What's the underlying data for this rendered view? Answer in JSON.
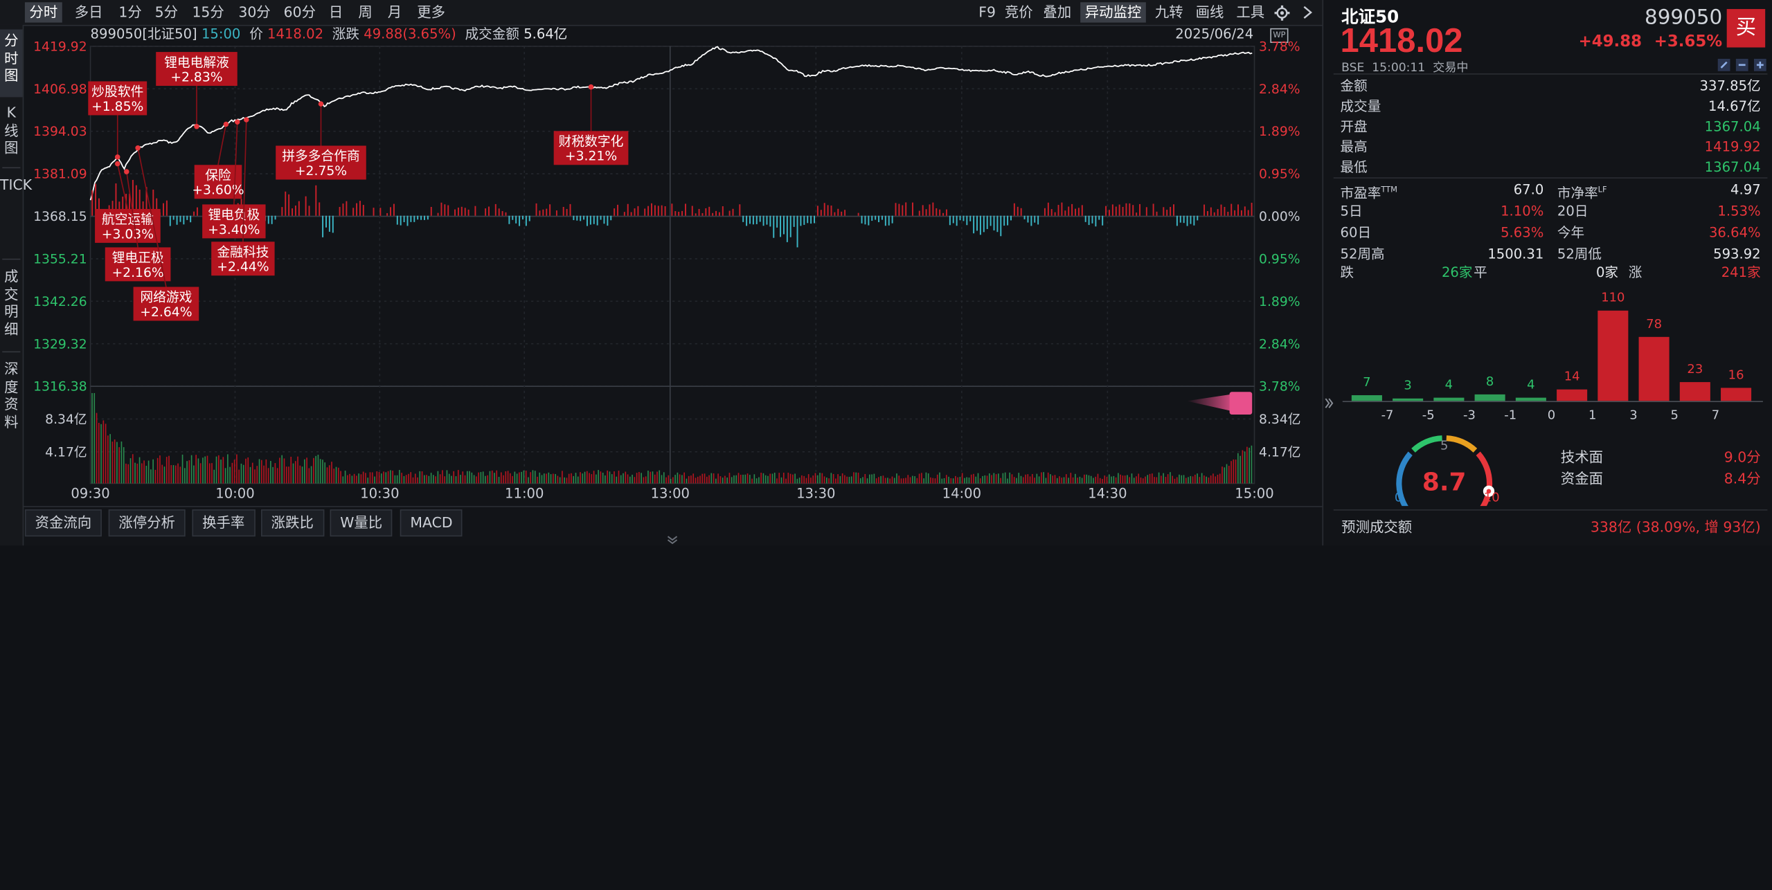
{
  "toolbar": {
    "left_tabs": [
      "分时",
      "多日",
      "1分",
      "5分",
      "15分",
      "30分",
      "60分",
      "日",
      "周",
      "月",
      "更多"
    ],
    "active_tab": "分时",
    "right_items": [
      "F9",
      "竞价",
      "叠加",
      "异动监控",
      "九转",
      "画线",
      "工具"
    ]
  },
  "side_tabs": [
    "分时图",
    "K线图",
    "TICK",
    "成交明细",
    "深度资料"
  ],
  "info_bar": {
    "code_name": "899050[北证50]",
    "time": "15:00",
    "price_label": "价",
    "price": "1418.02",
    "change_label": "涨跌",
    "change": "49.88(3.65%)",
    "amount_label": "成交金额",
    "amount": "5.64亿",
    "date": "2025/06/24",
    "wp_badge": "WP"
  },
  "axes": {
    "price_labels": [
      "1419.92",
      "1406.98",
      "1394.03",
      "1381.09",
      "1368.15",
      "1355.21",
      "1342.26",
      "1329.32",
      "1316.38"
    ],
    "pct_labels": [
      "3.78%",
      "2.84%",
      "1.89%",
      "0.95%",
      "0.00%",
      "0.95%",
      "1.89%",
      "2.84%",
      "3.78%"
    ],
    "vol_labels_left": [
      "8.34亿",
      "4.17亿"
    ],
    "vol_labels_right": [
      "3.78%",
      "8.34亿",
      "4.17亿"
    ],
    "time_labels": [
      "09:30",
      "10:00",
      "10:30",
      "11:00",
      "13:00",
      "13:30",
      "14:00",
      "14:30",
      "15:00"
    ]
  },
  "annotations": [
    {
      "name": "炒股软件",
      "pct": "+1.85%"
    },
    {
      "name": "锂电电解液",
      "pct": "+2.83%"
    },
    {
      "name": "拼多多合作商",
      "pct": "+2.75%"
    },
    {
      "name": "财税数字化",
      "pct": "+3.21%"
    },
    {
      "name": "保险",
      "pct": "+3.60%"
    },
    {
      "name": "航空运输",
      "pct": "+3.03%"
    },
    {
      "name": "锂电负极",
      "pct": "+3.40%"
    },
    {
      "name": "锂电正极",
      "pct": "+2.16%"
    },
    {
      "name": "金融科技",
      "pct": "+2.44%"
    },
    {
      "name": "网络游戏",
      "pct": "+2.64%"
    }
  ],
  "bottom_tabs": [
    "资金流向",
    "涨停分析",
    "换手率",
    "涨跌比",
    "W量比",
    "MACD"
  ],
  "quote": {
    "name": "北证50",
    "code": "899050",
    "price": "1418.02",
    "change": "+49.88",
    "change_pct": "+3.65%",
    "buy_label": "买",
    "status": "BSE  15:00:11  交易中"
  },
  "stats": [
    {
      "label": "金额",
      "value": "337.85亿",
      "color": "white"
    },
    {
      "label": "成交量",
      "value": "14.67亿",
      "color": "white"
    },
    {
      "label": "开盘",
      "value": "1367.04",
      "color": "green"
    },
    {
      "label": "最高",
      "value": "1419.92",
      "color": "red"
    },
    {
      "label": "最低",
      "value": "1367.04",
      "color": "green"
    }
  ],
  "stats2": [
    {
      "l1": "市盈率TTM",
      "v1": "67.0",
      "c1": "white",
      "l2": "市净率LF",
      "v2": "4.97",
      "c2": "white"
    },
    {
      "l1": "5日",
      "v1": "1.10%",
      "c1": "red",
      "l2": "20日",
      "v2": "1.53%",
      "c2": "red"
    },
    {
      "l1": "60日",
      "v1": "5.63%",
      "c1": "red",
      "l2": "今年",
      "v2": "36.64%",
      "c2": "red"
    },
    {
      "l1": "52周高",
      "v1": "1500.31",
      "c1": "white",
      "l2": "52周低",
      "v2": "593.92",
      "c2": "white"
    }
  ],
  "breadth": {
    "down_label": "跌",
    "down": "26家",
    "flat_label": "平",
    "flat": "0家",
    "up_label": "涨",
    "up": "241家"
  },
  "distribution": {
    "values": [
      7,
      3,
      4,
      8,
      4,
      14,
      110,
      78,
      23,
      16
    ],
    "colors": [
      "#2f9e58",
      "#2f9e58",
      "#2f9e58",
      "#2f9e58",
      "#2f9e58",
      "#c8202a",
      "#c8202a",
      "#c8202a",
      "#c8202a",
      "#c8202a"
    ],
    "tick_labels": [
      "-7",
      "-5",
      "-3",
      "-1",
      "0",
      "1",
      "3",
      "5",
      "7"
    ]
  },
  "gauge": {
    "score": "8.7",
    "min": "0",
    "mid": "5",
    "max": "10",
    "value_fraction": 0.87,
    "tech_label": "技术面",
    "tech_value": "9.0分",
    "fund_label": "资金面",
    "fund_value": "8.4分"
  },
  "forecast": {
    "label": "预测成交额",
    "value": "338亿 (38.09%, 增 93亿)"
  },
  "colors": {
    "up": "#e8363c",
    "down": "#2ec46b",
    "line": "#ffffff",
    "accent_box": "#b3141f",
    "cyan": "#3bb5c4"
  }
}
